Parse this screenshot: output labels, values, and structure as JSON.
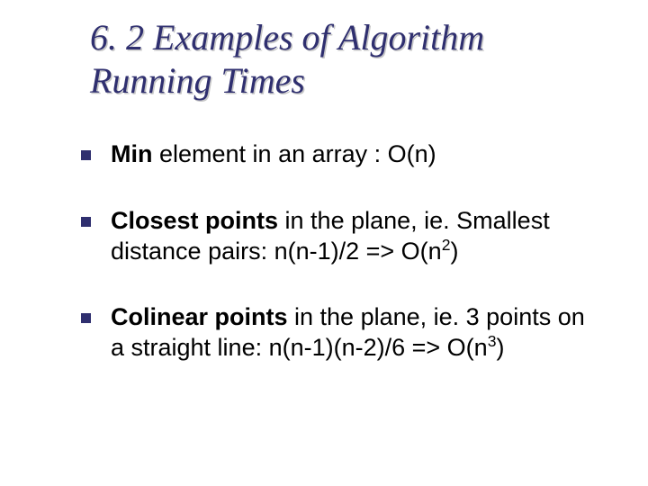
{
  "title": "6. 2 Examples of Algorithm Running Times",
  "items": [
    {
      "bold": "Min",
      "plain": " element in an array : O(n)"
    },
    {
      "bold": "Closest points",
      "plain": " in the plane, ie. Smallest distance pairs: n(n-1)/2  => O(n",
      "sup": "2",
      "tail": ")"
    },
    {
      "bold": "Colinear points",
      "plain": " in the plane, ie. 3 points on a straight line:  n(n-1)(n-2)/6 => O(n",
      "sup": "3",
      "tail": ")"
    }
  ]
}
